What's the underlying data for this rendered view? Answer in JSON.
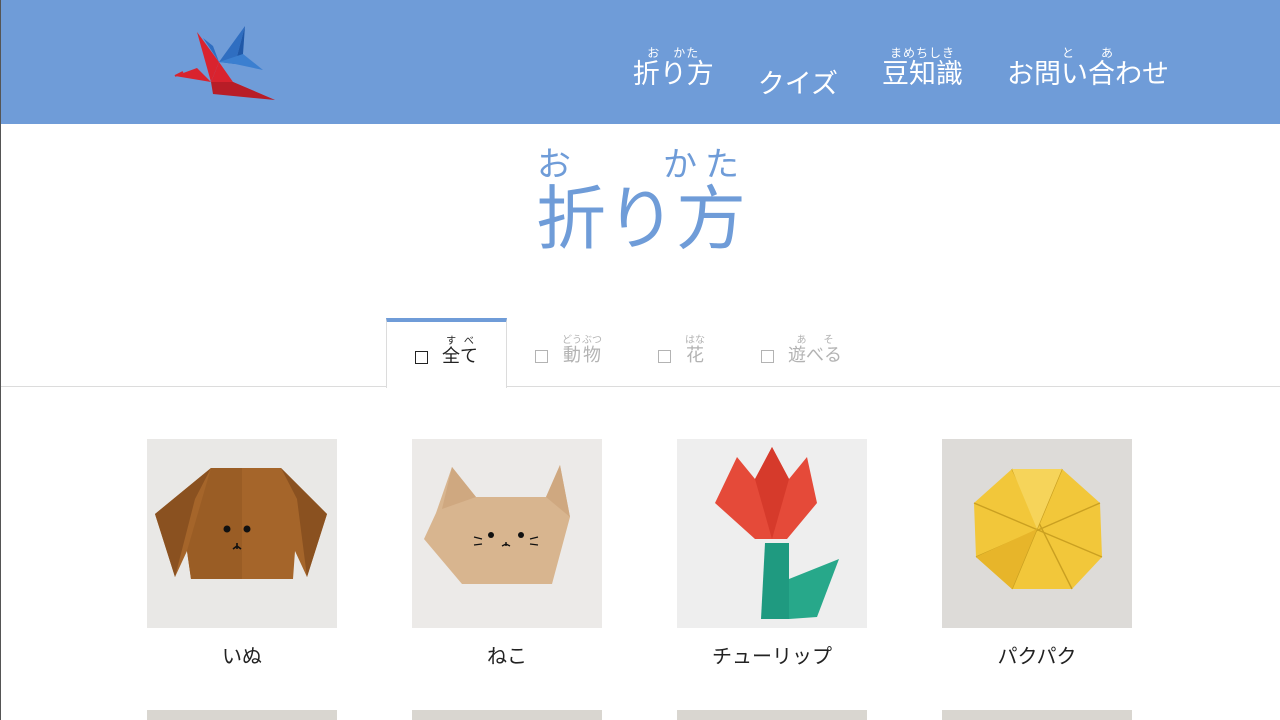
{
  "header": {
    "nav": [
      {
        "base": "折り方",
        "ruby": "お　かた",
        "type": "ruby"
      },
      {
        "base": "クイズ",
        "type": "plain"
      },
      {
        "base": "豆知識",
        "ruby": "まめちしき",
        "type": "ruby"
      },
      {
        "base": "お問い合わせ",
        "ruby": "と　　あ",
        "type": "ruby"
      }
    ]
  },
  "page_title": {
    "base": "折り方",
    "ruby": "お　　かた"
  },
  "tabs": [
    {
      "base": "全て",
      "ruby": "すべ",
      "active": true
    },
    {
      "base": "動物",
      "ruby": "どうぶつ",
      "active": false
    },
    {
      "base": "花",
      "ruby": "はな",
      "active": false
    },
    {
      "base": "遊べる",
      "ruby": "あそ",
      "active": false
    }
  ],
  "items": [
    {
      "label": "いぬ",
      "icon": "dog-origami"
    },
    {
      "label": "ねこ",
      "icon": "cat-origami"
    },
    {
      "label": "チューリップ",
      "icon": "tulip-origami"
    },
    {
      "label": "パクパク",
      "icon": "pakupaku-origami"
    }
  ],
  "colors": {
    "header_bg": "#6f9cd8",
    "title": "#6f9cd8",
    "tab_active_border": "#6f9cd8",
    "tab_inactive_text": "#b3b3b3"
  }
}
